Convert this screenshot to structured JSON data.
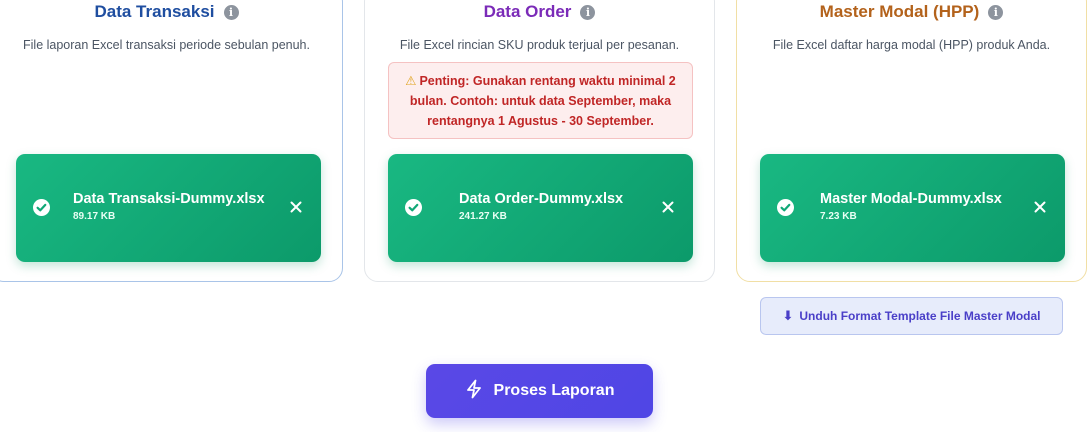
{
  "cards": [
    {
      "title": "Data Transaksi",
      "description": "File laporan Excel transaksi periode sebulan penuh.",
      "file": {
        "name": "Data Transaksi-Dummy.xlsx",
        "size": "89.17 KB"
      }
    },
    {
      "title": "Data Order",
      "description": "File Excel rincian SKU produk terjual per pesanan.",
      "warning": "Penting: Gunakan rentang waktu minimal 2 bulan. Contoh: untuk data September, maka rentangnya 1 Agustus - 30 September.",
      "file": {
        "name": "Data Order-Dummy.xlsx",
        "size": "241.27 KB"
      }
    },
    {
      "title": "Master Modal (HPP)",
      "description": "File Excel daftar harga modal (HPP) produk Anda.",
      "file": {
        "name": "Master Modal-Dummy.xlsx",
        "size": "7.23 KB"
      }
    }
  ],
  "template_button": {
    "label": "Unduh Format Template File Master Modal",
    "icon": "download-arrow-icon"
  },
  "process_button": {
    "label": "Proses Laporan",
    "icon": "lightning-icon"
  },
  "colors": {
    "file_success": "#10a877",
    "primary": "#4f46e5",
    "warning_text": "#c02626",
    "title_transaksi": "#1f4ea0",
    "title_order": "#7b2bb8",
    "title_master": "#b3621b"
  }
}
